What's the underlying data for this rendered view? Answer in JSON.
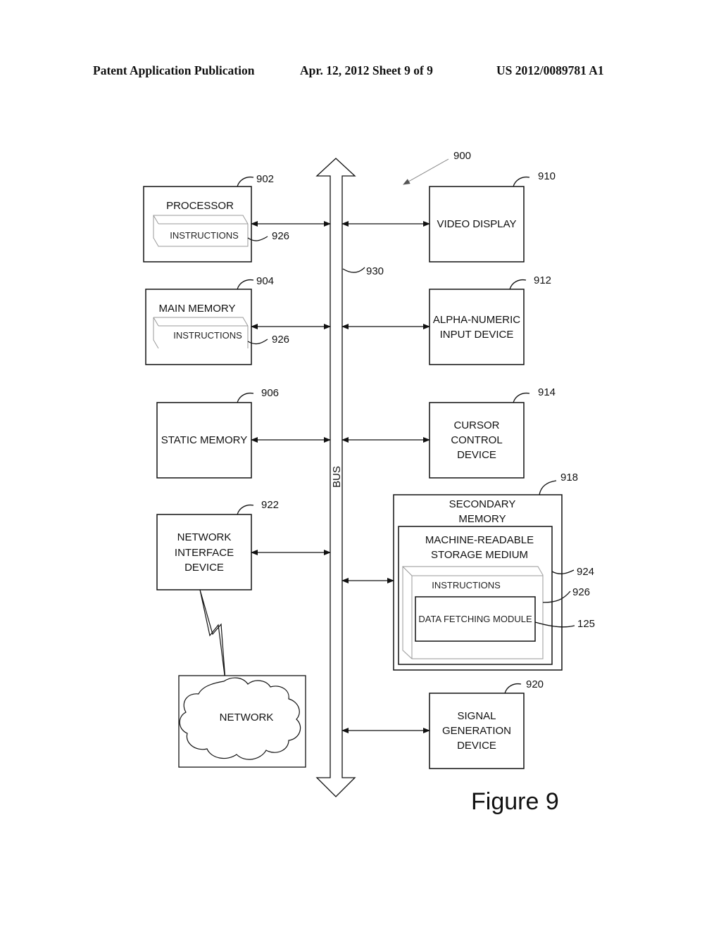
{
  "header": {
    "publication": "Patent Application Publication",
    "date_sheet": "Apr. 12, 2012  Sheet 9 of 9",
    "patent_number": "US 2012/0089781 A1"
  },
  "figure": {
    "title": "Figure 9",
    "system_ref": "900",
    "bus": {
      "label": "BUS",
      "ref": "930"
    },
    "processor": {
      "label": "PROCESSOR",
      "ref": "902",
      "inner_label": "INSTRUCTIONS",
      "inner_ref": "926"
    },
    "main_memory": {
      "label": "MAIN MEMORY",
      "ref": "904",
      "inner_label": "INSTRUCTIONS",
      "inner_ref": "926"
    },
    "static_memory": {
      "label": "STATIC MEMORY",
      "ref": "906"
    },
    "network_interface": {
      "lines": [
        "NETWORK",
        "INTERFACE",
        "DEVICE"
      ],
      "ref": "922"
    },
    "network": {
      "label": "NETWORK"
    },
    "video_display": {
      "label": "VIDEO DISPLAY",
      "ref": "910"
    },
    "alpha_numeric": {
      "lines": [
        "ALPHA-NUMERIC",
        "INPUT DEVICE"
      ],
      "ref": "912"
    },
    "cursor_control": {
      "lines": [
        "CURSOR",
        "CONTROL",
        "DEVICE"
      ],
      "ref": "914"
    },
    "secondary_memory": {
      "lines": [
        "SECONDARY",
        "MEMORY"
      ],
      "ref": "918",
      "storage_medium": {
        "lines": [
          "MACHINE-READABLE",
          "STORAGE MEDIUM"
        ],
        "ref": "924"
      },
      "instructions": {
        "label": "INSTRUCTIONS",
        "ref": "926"
      },
      "module": {
        "label": "DATA FETCHING MODULE",
        "ref": "125"
      }
    },
    "signal_generation": {
      "lines": [
        "SIGNAL",
        "GENERATION",
        "DEVICE"
      ],
      "ref": "920"
    }
  }
}
